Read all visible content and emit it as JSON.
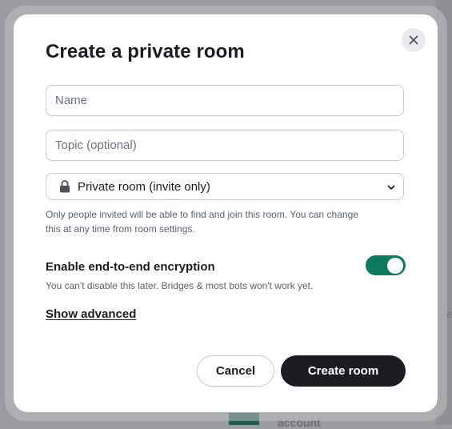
{
  "background": {
    "partial_text": "account",
    "edge_char": "e"
  },
  "dialog": {
    "title": "Create a private room",
    "close_icon": "close-icon",
    "name_field": {
      "placeholder": "Name",
      "value": ""
    },
    "topic_field": {
      "placeholder": "Topic (optional)",
      "value": ""
    },
    "visibility_select": {
      "icon": "lock-icon",
      "selected": "Private room (invite only)",
      "chevron_icon": "chevron-down-icon"
    },
    "visibility_help": "Only people invited will be able to find and join this room. You can change this at any time from room settings.",
    "encryption": {
      "label": "Enable end-to-end encryption",
      "enabled": true,
      "help": "You can't disable this later. Bridges & most bots won't work yet."
    },
    "show_advanced": "Show advanced",
    "cancel_label": "Cancel",
    "create_label": "Create room"
  },
  "colors": {
    "accent_toggle": "#0d7a5f",
    "primary_button": "#1b1d22"
  }
}
